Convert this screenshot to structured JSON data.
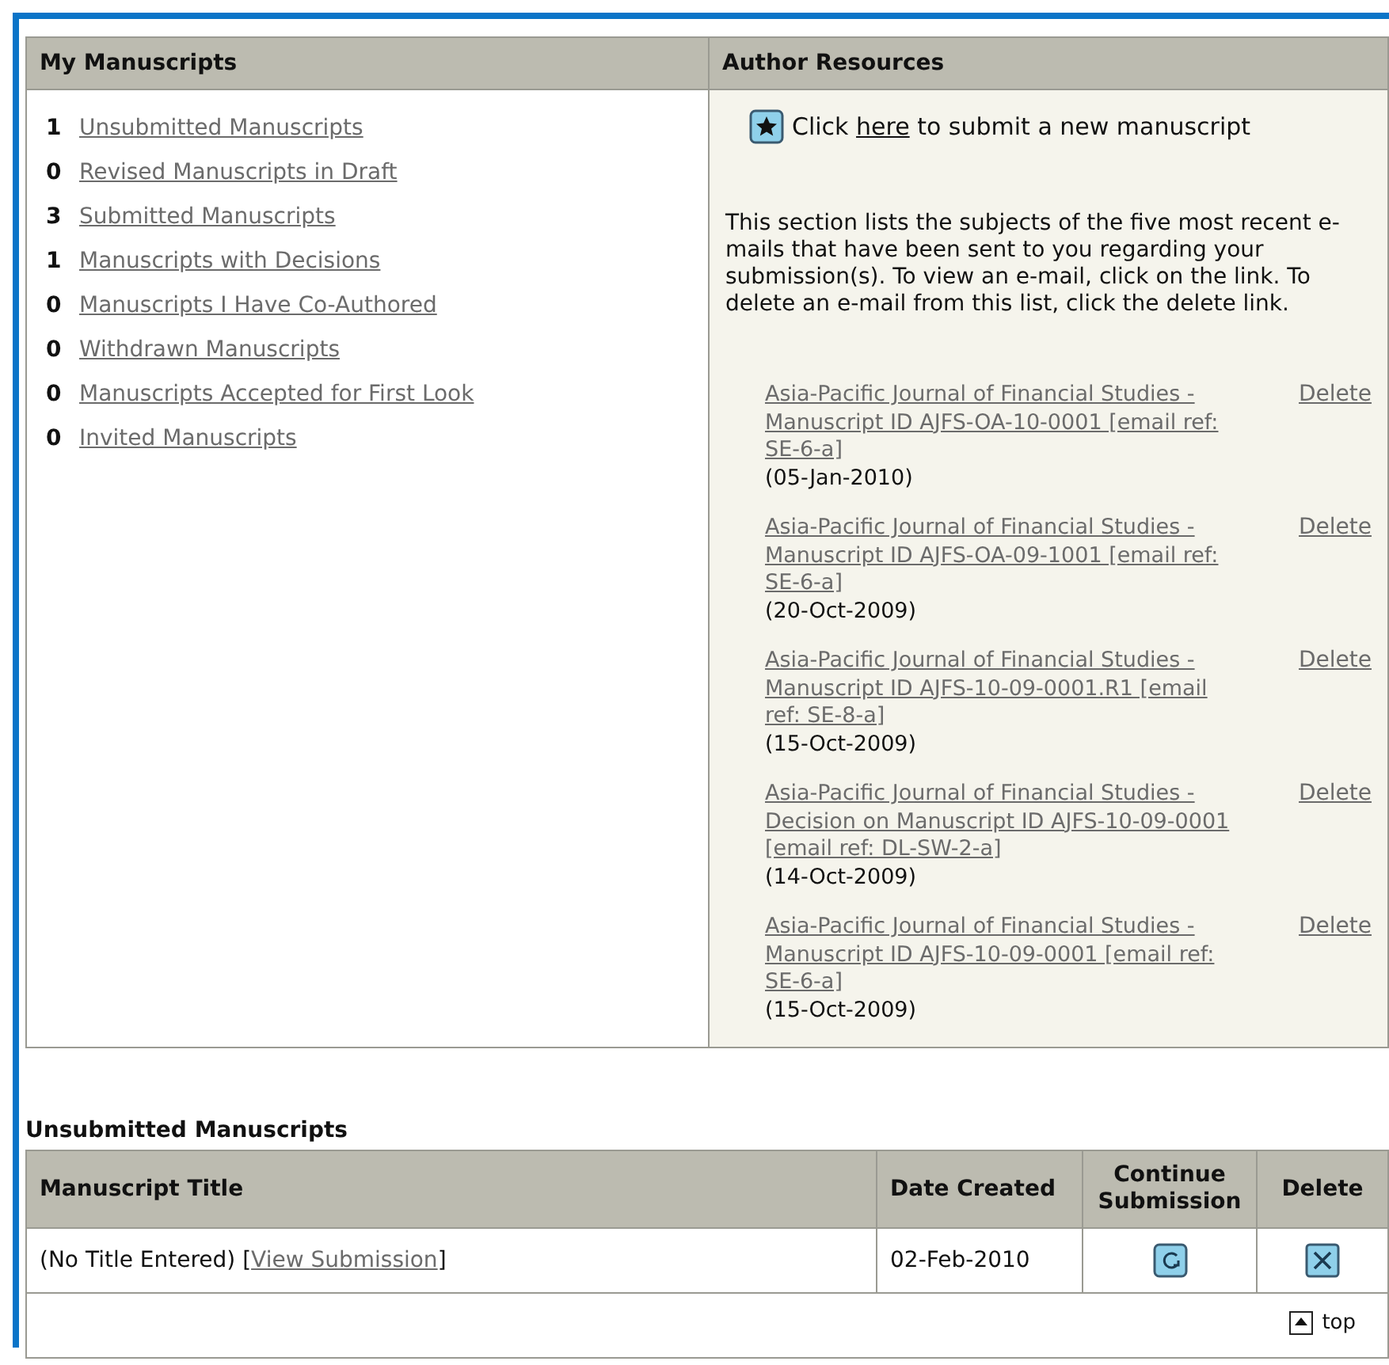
{
  "my_manuscripts": {
    "title": "My Manuscripts",
    "items": [
      {
        "count": "1",
        "label": "Unsubmitted Manuscripts"
      },
      {
        "count": "0",
        "label": "Revised Manuscripts in Draft"
      },
      {
        "count": "3",
        "label": "Submitted Manuscripts"
      },
      {
        "count": "1",
        "label": "Manuscripts with Decisions"
      },
      {
        "count": "0",
        "label": "Manuscripts I Have Co-Authored"
      },
      {
        "count": "0",
        "label": "Withdrawn Manuscripts"
      },
      {
        "count": "0",
        "label": "Manuscripts Accepted for First Look"
      },
      {
        "count": "0",
        "label": "Invited Manuscripts"
      }
    ]
  },
  "author_resources": {
    "title": "Author Resources",
    "submit_prefix": "Click",
    "submit_link": "here",
    "submit_suffix": "to submit a new manuscript",
    "description": "This section lists the subjects of the five most recent e-mails that have been sent to you regarding your submission(s). To view an e-mail, click on the link. To delete an e-mail from this list, click the delete link.",
    "emails": [
      {
        "subject": "Asia-Pacific Journal of Financial Studies - Manuscript ID AJFS-OA-10-0001 [email ref: SE-6-a]",
        "date": "(05-Jan-2010)",
        "delete": "Delete"
      },
      {
        "subject": "Asia-Pacific Journal of Financial Studies - Manuscript ID AJFS-OA-09-1001 [email ref: SE-6-a]",
        "date": "(20-Oct-2009)",
        "delete": "Delete"
      },
      {
        "subject": "Asia-Pacific Journal of Financial Studies - Manuscript ID AJFS-10-09-0001.R1 [email ref: SE-8-a]",
        "date": "(15-Oct-2009)",
        "delete": "Delete"
      },
      {
        "subject": "Asia-Pacific Journal of Financial Studies - Decision on Manuscript ID AJFS-10-09-0001 [email ref: DL-SW-2-a]",
        "date": "(14-Oct-2009)",
        "delete": "Delete"
      },
      {
        "subject": "Asia-Pacific Journal of Financial Studies - Manuscript ID AJFS-10-09-0001 [email ref: SE-6-a]",
        "date": "(15-Oct-2009)",
        "delete": "Delete"
      }
    ]
  },
  "unsubmitted": {
    "title": "Unsubmitted Manuscripts",
    "columns": [
      "Manuscript Title",
      "Date Created",
      "Continue Submission",
      "Delete"
    ],
    "rows": [
      {
        "title": "(No Title Entered)",
        "link_open": "[",
        "link": "View Submission",
        "link_close": "]",
        "date": "02-Feb-2010"
      }
    ],
    "top_link": "top"
  }
}
